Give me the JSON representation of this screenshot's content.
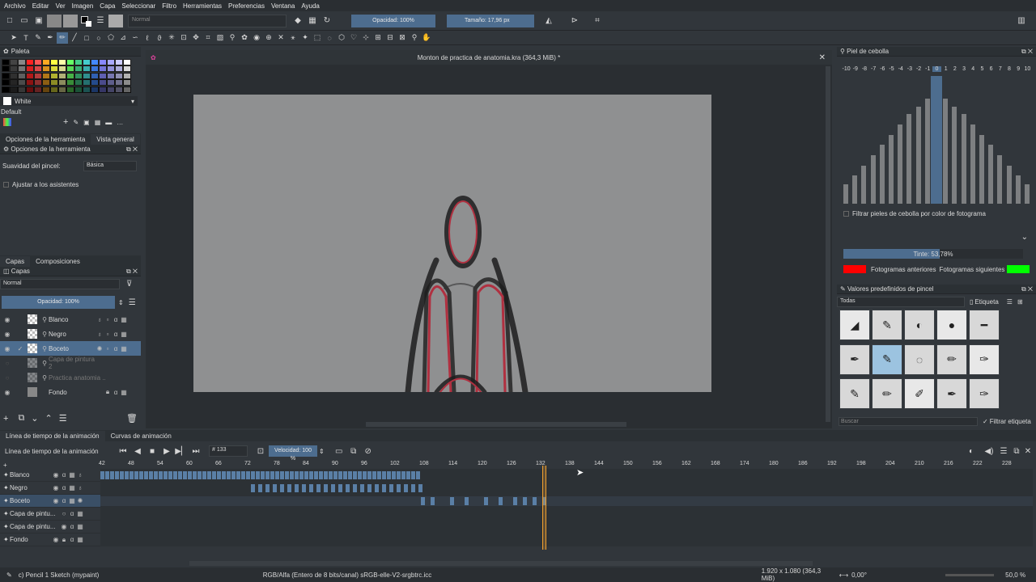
{
  "menu": [
    "Archivo",
    "Editar",
    "Ver",
    "Imagen",
    "Capa",
    "Seleccionar",
    "Filtro",
    "Herramientas",
    "Preferencias",
    "Ventana",
    "Ayuda"
  ],
  "toolbar": {
    "blend_mode": "Normal",
    "opacity": "Opacidad: 100%",
    "size": "Tamaño: 17,96 px"
  },
  "document": {
    "title": "Monton de practica de anatomia.kra (364,3 MiB) *"
  },
  "palette": {
    "title": "Palette",
    "title_es": "Paleta",
    "color_name": "White",
    "preset": "Default"
  },
  "tool_options": {
    "tabs": [
      "Opciones de la herramienta",
      "Vista general"
    ],
    "title": "Opciones de la herramienta",
    "smoothing_label": "Suavidad del pincel:",
    "smoothing_value": "Básica",
    "assistant_label": "Ajustar a los asistentes"
  },
  "layers": {
    "tabs": [
      "Capas",
      "Composiciones"
    ],
    "title": "Capas",
    "blend": "Normal",
    "opacity": "Opacidad:  100%",
    "items": [
      {
        "name": "Blanco"
      },
      {
        "name": "Negro"
      },
      {
        "name": "Boceto"
      },
      {
        "name": "Capa de pintura 2"
      },
      {
        "name": "Practica anatomia ..."
      },
      {
        "name": "Fondo"
      }
    ]
  },
  "onion": {
    "title": "Piel de cebolla",
    "ticks": [
      "-10",
      "-9",
      "-8",
      "-7",
      "-6",
      "-5",
      "-4",
      "-3",
      "-2",
      "-1",
      "0",
      "1",
      "2",
      "3",
      "4",
      "5",
      "6",
      "7",
      "8",
      "9",
      "10"
    ],
    "levels": [
      0.15,
      0.22,
      0.3,
      0.38,
      0.46,
      0.54,
      0.62,
      0.7,
      0.76,
      0.82,
      1.0,
      0.82,
      0.76,
      0.7,
      0.62,
      0.54,
      0.46,
      0.38,
      0.3,
      0.22,
      0.15
    ],
    "filter_label": "Filtrar pieles de cebolla por color de fotograma",
    "tint": "Tinte: 53,78%",
    "tint_level": 0.5378,
    "prev": "Fotogramas anteriores",
    "next": "Fotogramas siguientes",
    "prev_color": "#ff0000",
    "next_color": "#00ff00"
  },
  "brush_presets": {
    "title": "Valores predefinidos de pincel",
    "filter": "Todas",
    "tag": "Etiqueta",
    "search": "Buscar",
    "filter_tag": "Filtrar etiqueta"
  },
  "timeline": {
    "tabs": [
      "Línea de tiempo de la animación",
      "Curvas de animación"
    ],
    "title": "Línea de tiempo de la animación",
    "frame": "133",
    "speed": "Velocidad: 100 %",
    "ruler": [
      "42",
      "48",
      "54",
      "60",
      "66",
      "72",
      "78",
      "84",
      "90",
      "96",
      "102",
      "108",
      "114",
      "120",
      "126",
      "132",
      "138",
      "144",
      "150",
      "156",
      "162",
      "168",
      "174",
      "180",
      "186",
      "192",
      "198",
      "204",
      "210",
      "216",
      "222",
      "228"
    ],
    "layers": [
      "Blanco",
      "Negro",
      "Boceto",
      "Capa de pintu...",
      "Capa de pintu...",
      "Fondo"
    ]
  },
  "status": {
    "brush": "c) Pencil 1 Sketch (mypaint)",
    "color_space": "RGB/Alfa (Entero de 8 bits/canal)  sRGB-elle-V2-srgbtrc.icc",
    "dims": "1.920 x 1.080 (364,3 MiB)",
    "rotation": "0,00°",
    "zoom": "50,0 %"
  }
}
